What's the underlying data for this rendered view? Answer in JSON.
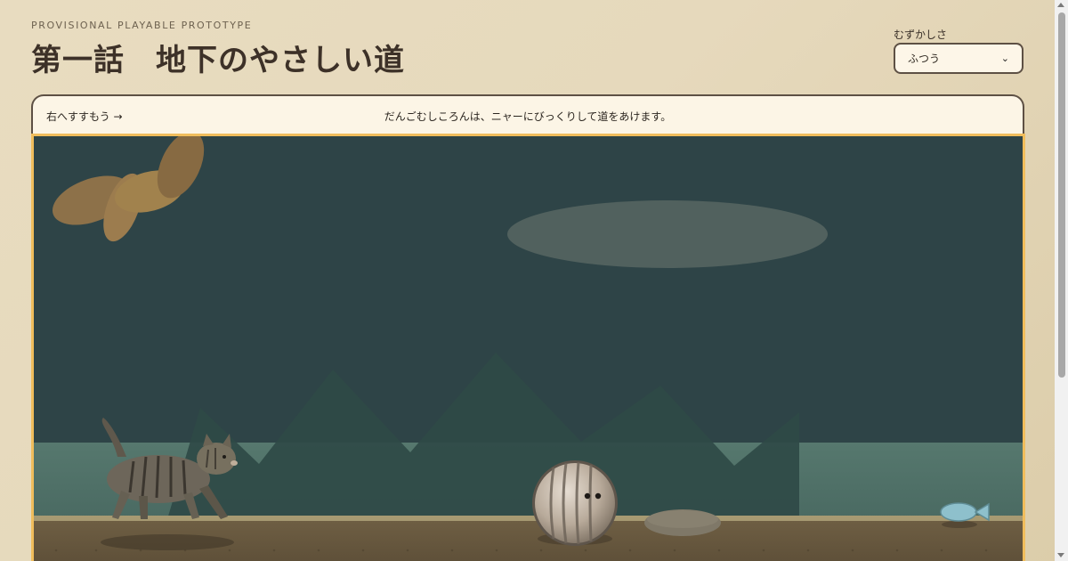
{
  "header": {
    "subtitle": "PROVISIONAL PLAYABLE PROTOTYPE",
    "title": "第一話　地下のやさしい道"
  },
  "difficulty": {
    "label": "むずかしさ",
    "selected": "ふつう"
  },
  "infobar": {
    "hint": "右へすすもう →",
    "message": "だんごむしころんは、ニャーにびっくりして道をあけます。"
  },
  "colors": {
    "stage_border": "#f0bd5c",
    "cave_background": "#2e4447",
    "ground": "#6b5b40"
  },
  "icons": {
    "select_arrow": "chevron-down-icon",
    "scroll_up": "arrow-up-icon",
    "scroll_down": "arrow-down-icon"
  }
}
